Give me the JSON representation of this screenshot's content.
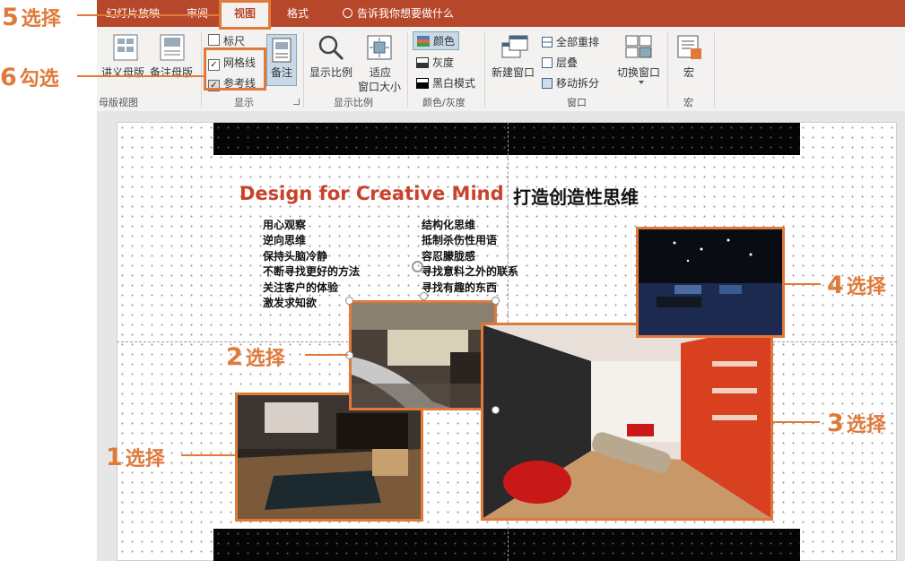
{
  "tabs": [
    {
      "label": "幻灯片放映",
      "active": false
    },
    {
      "label": "审阅",
      "active": false
    },
    {
      "label": "视图",
      "active": true
    },
    {
      "label": "格式",
      "active": false
    }
  ],
  "tell_me": "告诉我你想要做什么",
  "ribbon": {
    "master_views": {
      "handout_master": "讲义母版",
      "notes_master": "备注母版",
      "group_label": "母版视图"
    },
    "show": {
      "ruler": "标尺",
      "gridlines": "网格线",
      "guides": "参考线",
      "notes": "备注",
      "group_label": "显示",
      "ruler_checked": false,
      "gridlines_checked": true,
      "guides_checked": true
    },
    "zoom": {
      "zoom": "显示比例",
      "fit_line1": "适应",
      "fit_line2": "窗口大小",
      "group_label": "显示比例"
    },
    "color": {
      "color": "颜色",
      "grayscale": "灰度",
      "bw": "黑白模式",
      "group_label": "颜色/灰度"
    },
    "window": {
      "new_window": "新建窗口",
      "arrange_all": "全部重排",
      "cascade": "层叠",
      "move_split": "移动拆分",
      "switch_window": "切换窗口",
      "group_label": "窗口"
    },
    "macros": {
      "macros": "宏",
      "group_label": "宏"
    }
  },
  "slide": {
    "title_en": "Design for Creative Mind",
    "title_cn": "打造创造性思维",
    "list_left": [
      "用心观察",
      "逆向思维",
      "保持头脑冷静",
      "不断寻找更好的方法",
      "关注客户的体验",
      "激发求知欲"
    ],
    "list_right": [
      "结构化思维",
      "抵制杀伤性用语",
      "容忍朦胧感",
      "寻找意料之外的联系",
      "寻找有趣的东西"
    ]
  },
  "callouts": {
    "c1": {
      "num": "1",
      "text": "选择"
    },
    "c2": {
      "num": "2",
      "text": "选择"
    },
    "c3": {
      "num": "3",
      "text": "选择"
    },
    "c4": {
      "num": "4",
      "text": "选择"
    },
    "c5": {
      "num": "5",
      "text": "选择"
    },
    "c6": {
      "num": "6",
      "text": "勾选"
    }
  },
  "colors": {
    "accent": "#e07a3a",
    "ribbon_tab": "#b7472a",
    "title_red": "#c9432c"
  }
}
